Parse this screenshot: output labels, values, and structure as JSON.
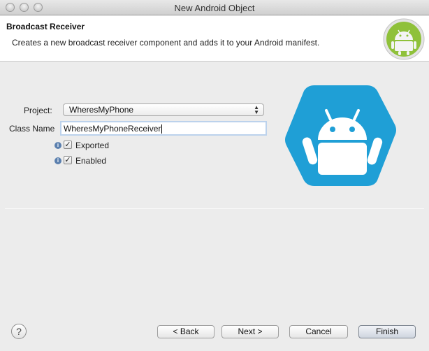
{
  "window": {
    "title": "New Android Object"
  },
  "header": {
    "title": "Broadcast Receiver",
    "description": "Creates a new broadcast receiver component and adds it to your Android manifest."
  },
  "form": {
    "project_label": "Project:",
    "project_value": "WheresMyPhone",
    "classname_label": "Class Name",
    "classname_value": "WheresMyPhoneReceiver",
    "exported_label": "Exported",
    "exported_checked": true,
    "enabled_label": "Enabled",
    "enabled_checked": true
  },
  "buttons": {
    "help": "?",
    "back": "< Back",
    "next": "Next >",
    "cancel": "Cancel",
    "finish": "Finish"
  },
  "icons": {
    "header_logo": "android-logo-icon",
    "big": "android-hexagon-icon",
    "info": "info-icon"
  },
  "colors": {
    "android_blue": "#1f9fd6",
    "android_green": "#8fc13a",
    "focus_ring": "#bcd2ec"
  }
}
